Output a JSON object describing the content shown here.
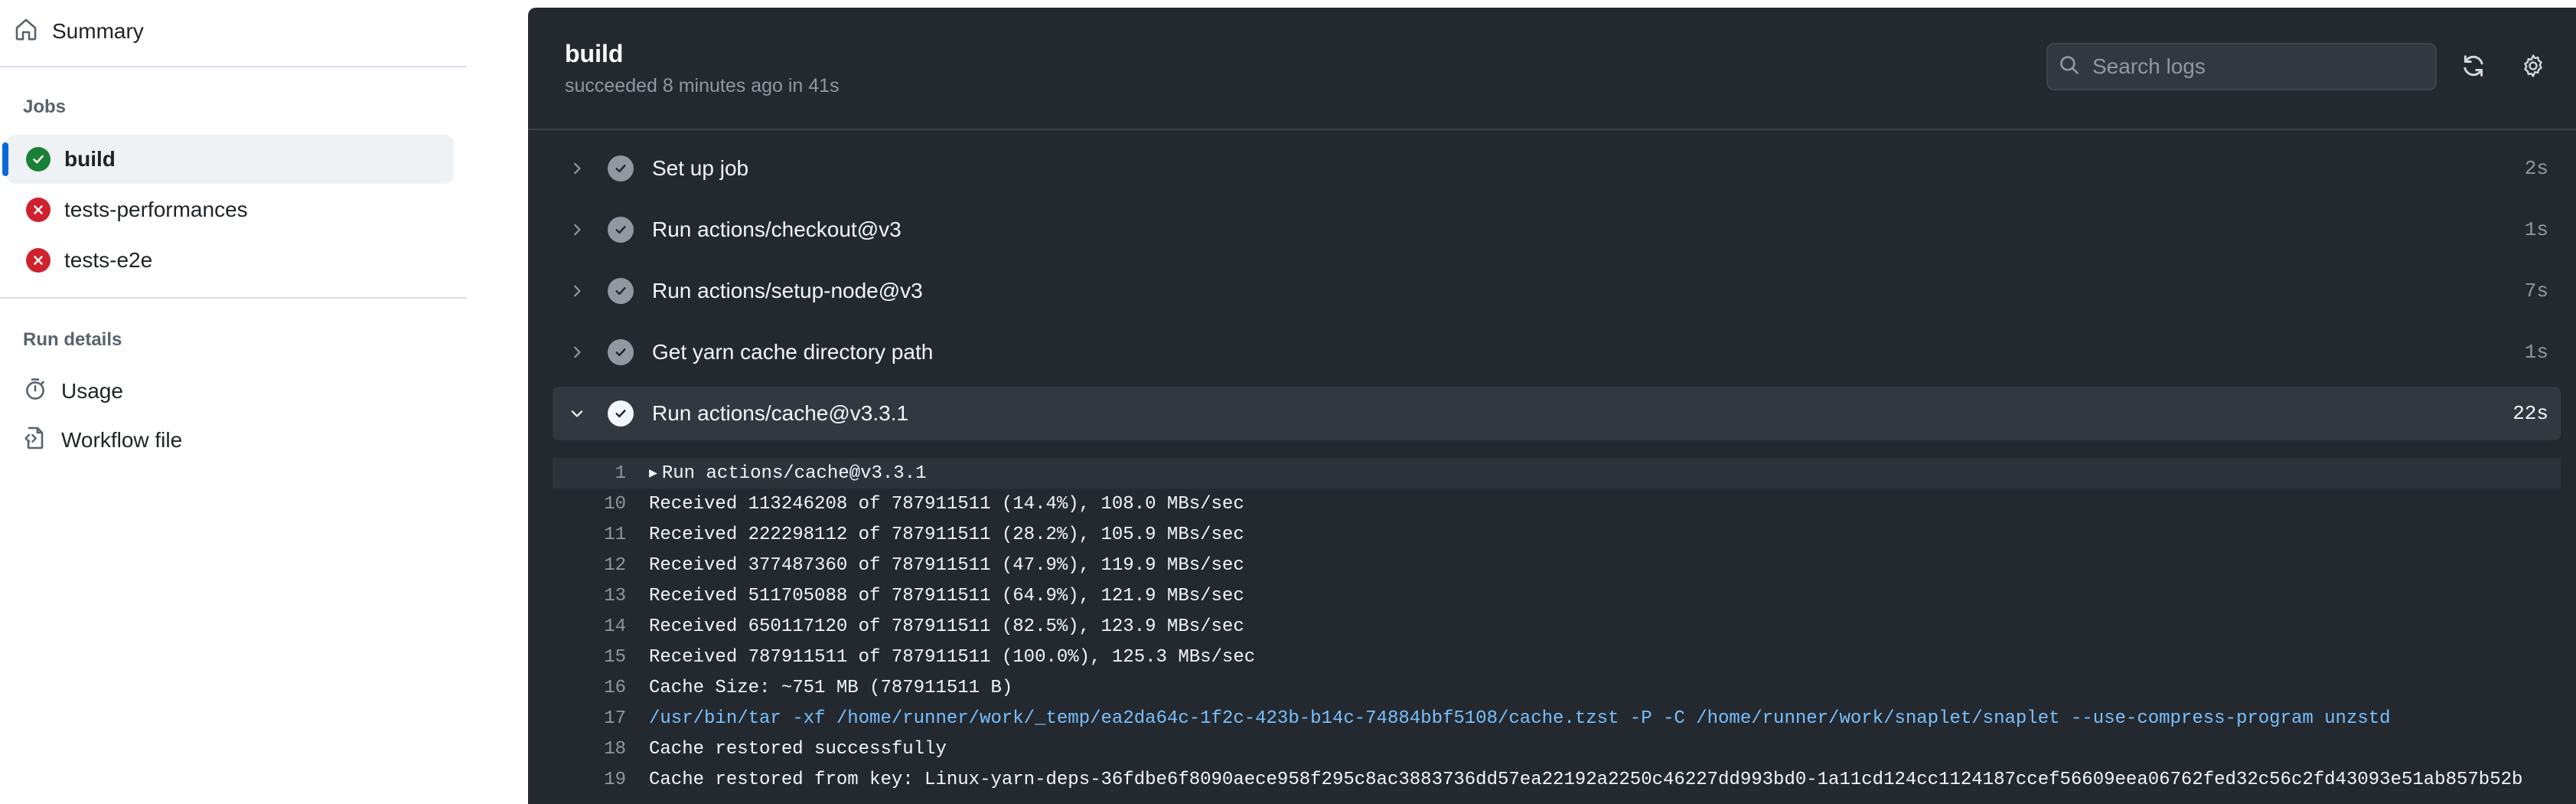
{
  "sidebar": {
    "summary_label": "Summary",
    "jobs_heading": "Jobs",
    "jobs": [
      {
        "label": "build",
        "status": "success"
      },
      {
        "label": "tests-performances",
        "status": "failure"
      },
      {
        "label": "tests-e2e",
        "status": "failure"
      }
    ],
    "run_details_heading": "Run details",
    "usage_label": "Usage",
    "workflow_file_label": "Workflow file"
  },
  "header": {
    "title": "build",
    "subtitle": "succeeded 8 minutes ago in 41s",
    "search_placeholder": "Search logs"
  },
  "steps": [
    {
      "name": "Set up job",
      "duration": "2s",
      "expanded": false
    },
    {
      "name": "Run actions/checkout@v3",
      "duration": "1s",
      "expanded": false
    },
    {
      "name": "Run actions/setup-node@v3",
      "duration": "7s",
      "expanded": false
    },
    {
      "name": "Get yarn cache directory path",
      "duration": "1s",
      "expanded": false
    },
    {
      "name": "Run actions/cache@v3.3.1",
      "duration": "22s",
      "expanded": true
    }
  ],
  "log_lines": [
    {
      "num": "1",
      "text": "Run actions/cache@v3.3.1",
      "kind": "group"
    },
    {
      "num": "10",
      "text": "Received 113246208 of 787911511 (14.4%), 108.0 MBs/sec",
      "kind": "normal"
    },
    {
      "num": "11",
      "text": "Received 222298112 of 787911511 (28.2%), 105.9 MBs/sec",
      "kind": "normal"
    },
    {
      "num": "12",
      "text": "Received 377487360 of 787911511 (47.9%), 119.9 MBs/sec",
      "kind": "normal"
    },
    {
      "num": "13",
      "text": "Received 511705088 of 787911511 (64.9%), 121.9 MBs/sec",
      "kind": "normal"
    },
    {
      "num": "14",
      "text": "Received 650117120 of 787911511 (82.5%), 123.9 MBs/sec",
      "kind": "normal"
    },
    {
      "num": "15",
      "text": "Received 787911511 of 787911511 (100.0%), 125.3 MBs/sec",
      "kind": "normal"
    },
    {
      "num": "16",
      "text": "Cache Size: ~751 MB (787911511 B)",
      "kind": "normal"
    },
    {
      "num": "17",
      "text": "/usr/bin/tar -xf /home/runner/work/_temp/ea2da64c-1f2c-423b-b14c-74884bbf5108/cache.tzst -P -C /home/runner/work/snaplet/snaplet --use-compress-program unzstd",
      "kind": "command"
    },
    {
      "num": "18",
      "text": "Cache restored successfully",
      "kind": "normal"
    },
    {
      "num": "19",
      "text": "Cache restored from key: Linux-yarn-deps-36fdbe6f8090aece958f295c8ac3883736dd57ea22192a2250c46227dd993bd0-1a11cd124cc1124187ccef56609eea06762fed32c56c2fd43093e51ab857b52b",
      "kind": "normal"
    }
  ],
  "colors": {
    "success": "#1a7f37",
    "failure": "#cf222e",
    "accent": "#0969da",
    "panel_bg": "#24292f",
    "command_text": "#79c0ff"
  }
}
